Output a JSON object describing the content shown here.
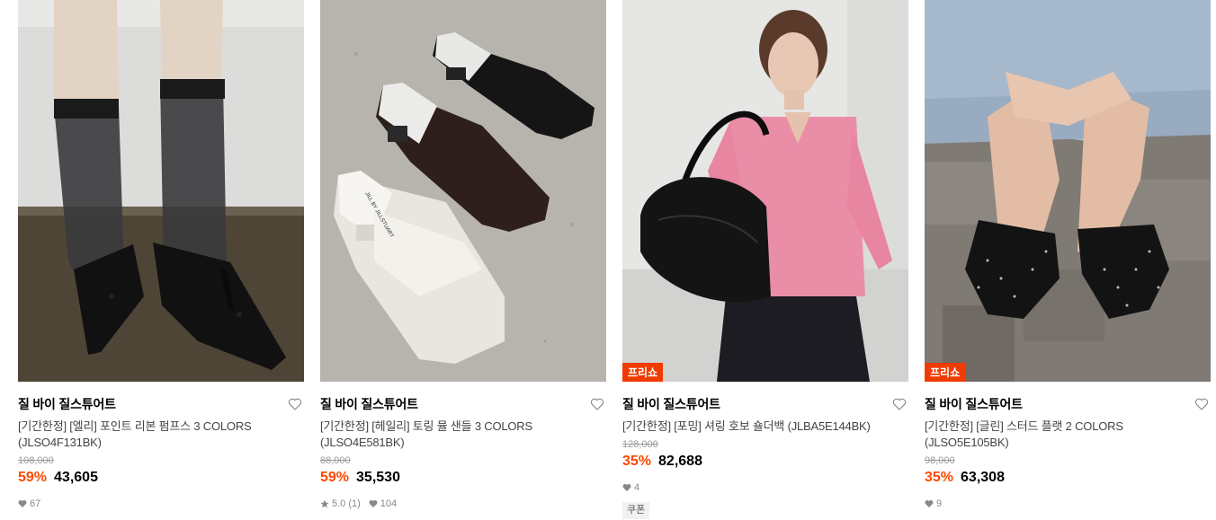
{
  "products": [
    {
      "brand": "질 바이 질스튜어트",
      "title_line1": "[기간한정] [엘리] 포인트 리본 펌프스 3 COLORS",
      "title_line2": "(JLSO4F131BK)",
      "original_price": "108,000",
      "discount_rate": "59%",
      "sale_price": "43,605",
      "likes": "67",
      "image_subject": "black pointed bow pumps with sheer black socks"
    },
    {
      "brand": "질 바이 질스튜어트",
      "title_line1": "[기간한정] [헤일리] 토링 뮬 샌들 3 COLORS",
      "title_line2": "(JLSO4E581BK)",
      "original_price": "88,000",
      "discount_rate": "59%",
      "sale_price": "35,530",
      "rating": "5.0 (1)",
      "likes": "104",
      "image_subject": "toe ring mule sandals in black, brown, ivory",
      "shoe_label": "JILL BY JILLSTUART"
    },
    {
      "badge": "프리쇼",
      "brand": "질 바이 질스튜어트",
      "title_line1": "[기간한정] [포밍] 셔링 호보 숄더백 (JLBA5E144BK)",
      "original_price": "128,000",
      "discount_rate": "35%",
      "sale_price": "82,688",
      "likes": "4",
      "coupon": "쿠폰",
      "image_subject": "model in pink cardigan with black shirred hobo bag"
    },
    {
      "badge": "프리쇼",
      "brand": "질 바이 질스튜어트",
      "title_line1": "[기간한정] [글린] 스터드 플랫 2 COLORS",
      "title_line2": "(JLSO5E105BK)",
      "original_price": "98,000",
      "discount_rate": "35%",
      "sale_price": "63,308",
      "likes": "9",
      "image_subject": "black studded flats on cobblestones"
    }
  ],
  "colors": {
    "discount": "#ff4800",
    "badge": "#f03b00",
    "muted": "#9a9a9a"
  },
  "icons": [
    "heart-outline-icon",
    "heart-filled-icon",
    "star-icon"
  ]
}
